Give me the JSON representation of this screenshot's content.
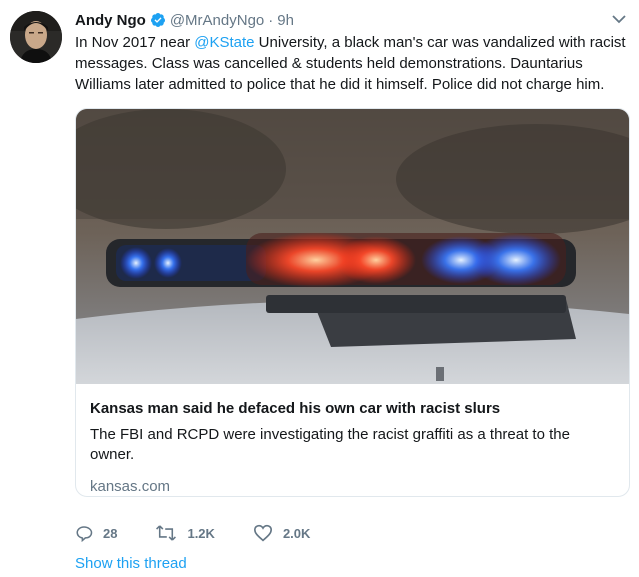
{
  "tweet": {
    "author_name": "Andy Ngo",
    "handle": "@MrAndyNgo",
    "separator": "·",
    "time": "9h",
    "text_before_mention": "In Nov 2017 near ",
    "mention": "@KState",
    "text_after_mention": " University, a black man's car was vandalized with racist messages. Class was cancelled & students held demonstrations. Dauntarius Williams later admitted to police that he did it himself. Police did not charge him."
  },
  "card": {
    "title": "Kansas man said he defaced his own car with racist slurs",
    "description": "The FBI and RCPD were investigating the racist graffiti as a threat to the owner.",
    "domain": "kansas.com"
  },
  "actions": {
    "reply_count": "28",
    "retweet_count": "1.2K",
    "like_count": "2.0K"
  },
  "show_thread": "Show this thread",
  "colors": {
    "accent": "#1da1f2",
    "secondary_text": "#657786",
    "border": "#e1e8ed"
  },
  "icons": [
    "verified-badge-icon",
    "chevron-down-icon",
    "reply-icon",
    "retweet-icon",
    "like-icon"
  ]
}
